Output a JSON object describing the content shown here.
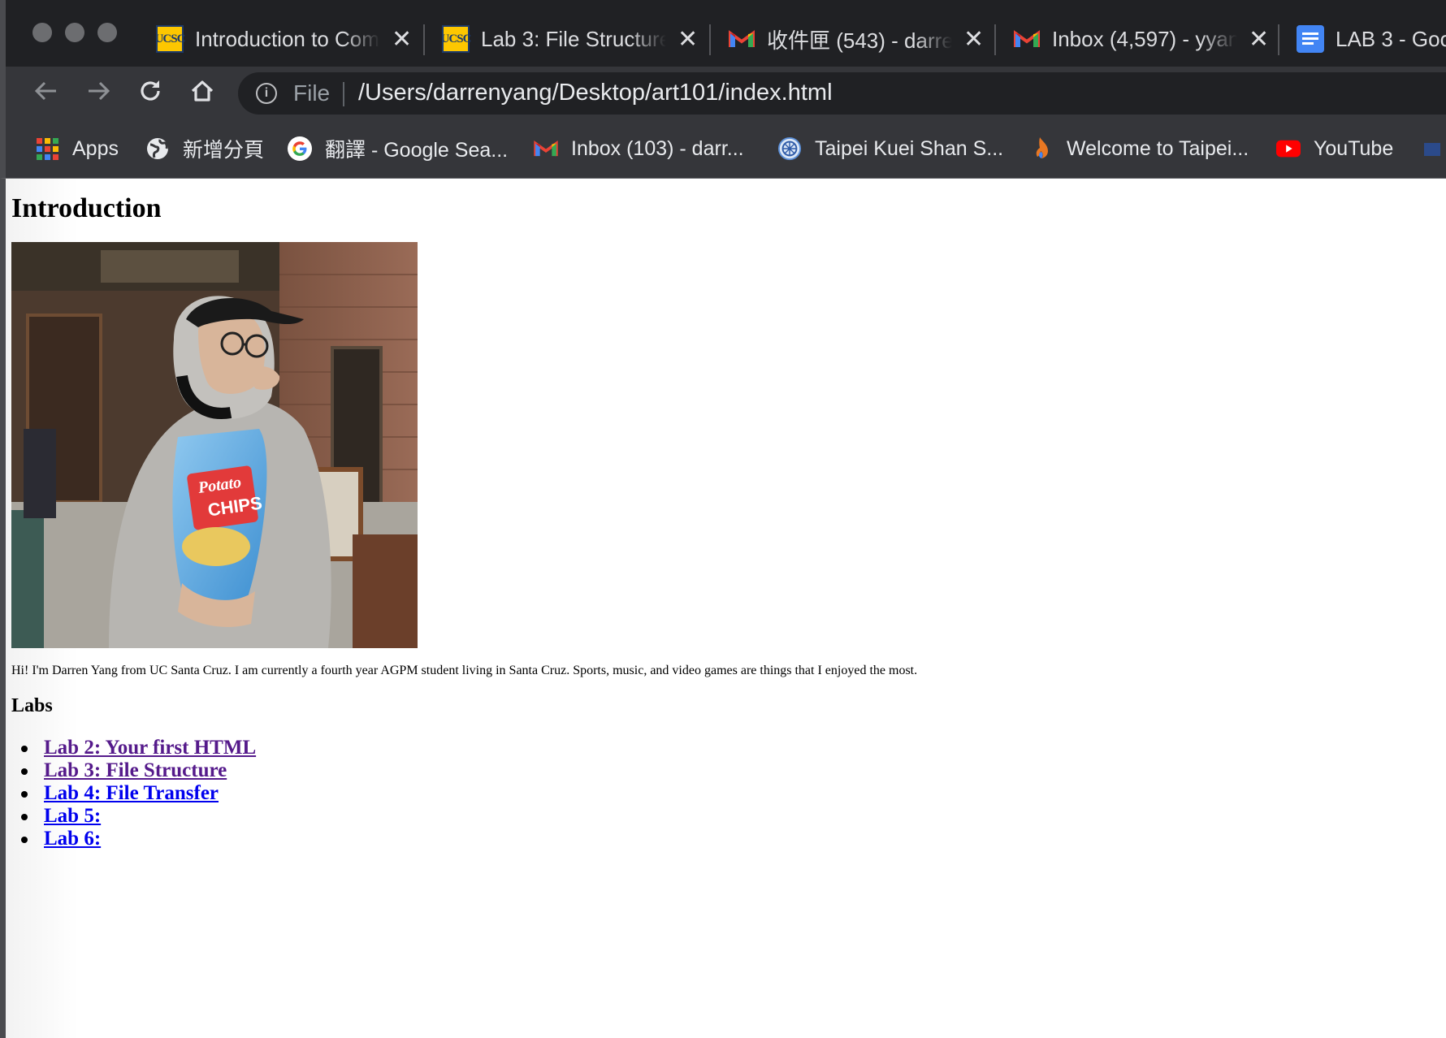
{
  "tabs": [
    {
      "title": "Introduction to Com",
      "icon": "ucsc-favicon",
      "icon_text": "UCSC"
    },
    {
      "title": "Lab 3: File Structure",
      "icon": "ucsc-favicon",
      "icon_text": "UCSC"
    },
    {
      "title": "收件匣 (543) - darre",
      "icon": "gmail-icon"
    },
    {
      "title": "Inbox (4,597) - yyan",
      "icon": "gmail-icon"
    },
    {
      "title": "LAB 3 - Goog",
      "icon": "google-docs-icon"
    }
  ],
  "address_bar": {
    "scheme_label": "File",
    "url": "/Users/darrenyang/Desktop/art101/index.html"
  },
  "bookmarks": [
    {
      "label": "Apps",
      "icon": "apps-grid-icon"
    },
    {
      "label": "新增分頁",
      "icon": "globe-icon"
    },
    {
      "label": "翻譯 - Google Sea...",
      "icon": "google-g-icon"
    },
    {
      "label": "Inbox (103) - darr...",
      "icon": "gmail-icon"
    },
    {
      "label": "Taipei Kuei Shan S...",
      "icon": "school-globe-icon"
    },
    {
      "label": "Welcome to Taipei...",
      "icon": "flame-icon"
    },
    {
      "label": "YouTube",
      "icon": "youtube-icon"
    }
  ],
  "page": {
    "heading": "Introduction",
    "photo_label_top": "Potato",
    "photo_label_bottom": "CHIPS",
    "bio": "Hi! I'm Darren Yang from UC Santa Cruz. I am currently a fourth year AGPM student living in Santa Cruz. Sports, music, and video games are things that I enjoyed the most.",
    "labs_heading": "Labs",
    "labs": [
      {
        "label": "Lab 2: Your first HTML",
        "visited": true
      },
      {
        "label": "Lab 3: File Structure",
        "visited": true
      },
      {
        "label": "Lab 4: File Transfer",
        "visited": false
      },
      {
        "label": "Lab 5:",
        "visited": false
      },
      {
        "label": "Lab 6:",
        "visited": false
      }
    ]
  },
  "colors": {
    "tabstrip": "#202124",
    "toolbar": "#35363a",
    "visited_link": "#551a8b",
    "link": "#0000ee"
  }
}
